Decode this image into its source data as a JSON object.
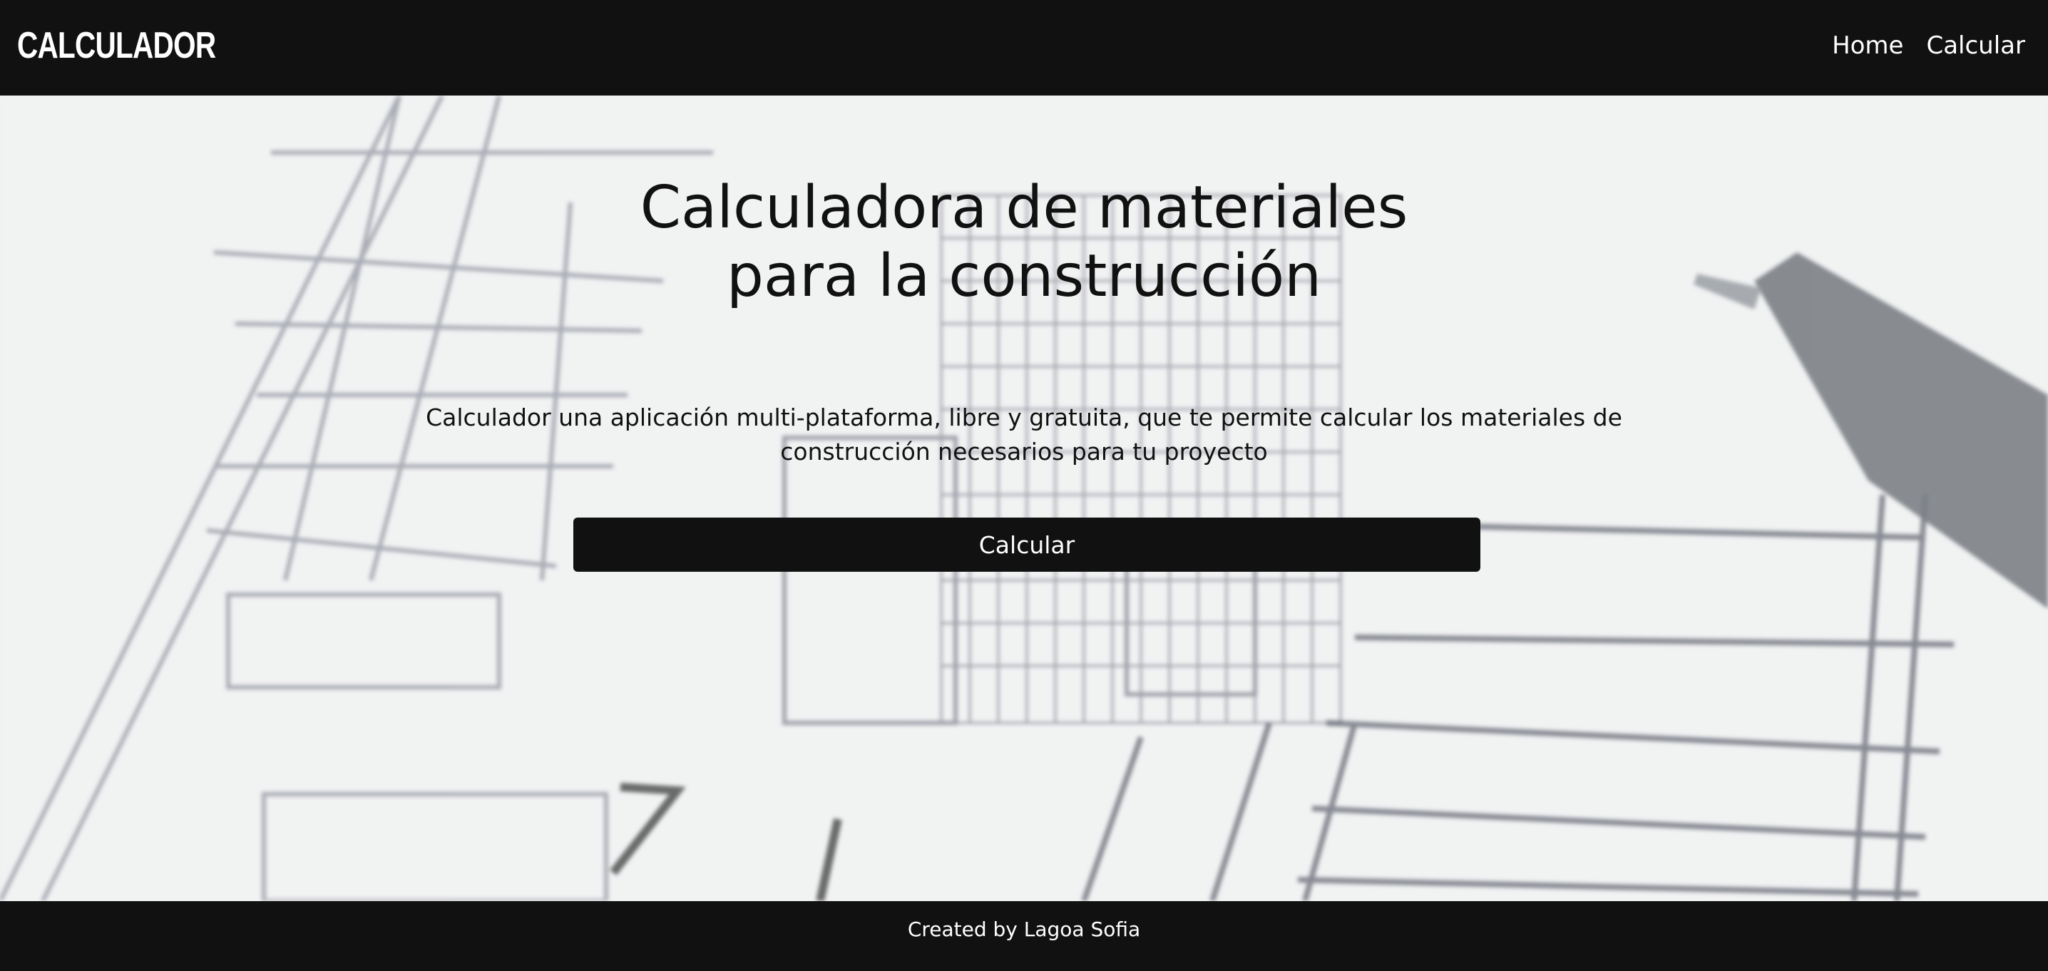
{
  "header": {
    "brand": "CALCULADOR",
    "nav": [
      {
        "label": "Home"
      },
      {
        "label": "Calcular"
      }
    ]
  },
  "hero": {
    "title_line1": "Calculadora de materiales",
    "title_line2": "para la construcción",
    "description": "Calculador una aplicación multi-plataforma, libre y gratuita, que te permite calcular los materiales de construcción necesarios para tu proyecto",
    "cta_label": "Calcular"
  },
  "footer": {
    "credit": "Created by Lagoa Sofia"
  },
  "colors": {
    "dark": "#111111",
    "text_light": "#ffffff",
    "hero_bg": "#e9eaeb"
  }
}
